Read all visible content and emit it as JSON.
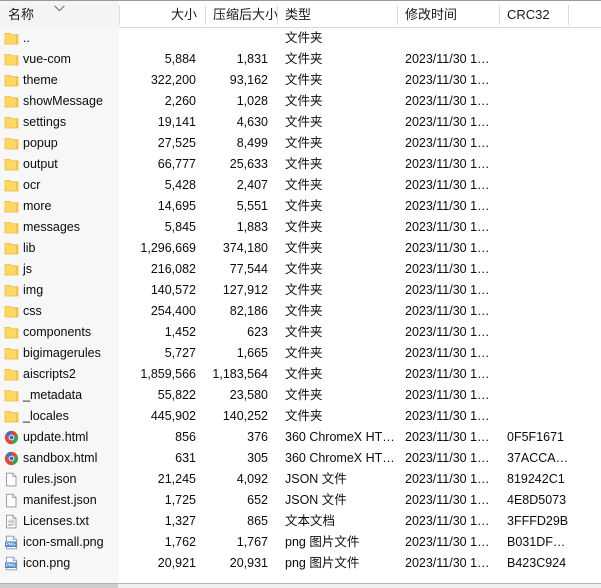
{
  "header": {
    "columns": [
      {
        "key": "name",
        "label": "名称",
        "align": "left",
        "sorted": true
      },
      {
        "key": "size",
        "label": "大小",
        "align": "right",
        "sorted": false
      },
      {
        "key": "packed",
        "label": "压缩后大小",
        "align": "right",
        "sorted": false
      },
      {
        "key": "type",
        "label": "类型",
        "align": "left",
        "sorted": false
      },
      {
        "key": "mtime",
        "label": "修改时间",
        "align": "left",
        "sorted": false
      },
      {
        "key": "crc",
        "label": "CRC32",
        "align": "left",
        "sorted": false
      }
    ],
    "sort_indicator_icon": "chevron-down-icon",
    "sort_column": "名称"
  },
  "type_labels": {
    "folder": "文件夹",
    "html": "360 ChromeX HT…",
    "json": "JSON 文件",
    "txt": "文本文档",
    "png": "png 图片文件"
  },
  "colors": {
    "folder_icon": "#ffd866",
    "folder_icon_border": "#e8b93d",
    "png_badge": "#4a86c8",
    "name_column_bg": "#f7f7f7",
    "header_rule": "#d8d8d8",
    "divider": "#dcdcdc",
    "text": "#0b0b0b"
  },
  "rows": [
    {
      "icon": "folder-icon",
      "name": "..",
      "size": "",
      "packed": "",
      "type": "文件夹",
      "mtime": "",
      "crc": ""
    },
    {
      "icon": "folder-icon",
      "name": "vue-com",
      "size": "5,884",
      "packed": "1,831",
      "type": "文件夹",
      "mtime": "2023/11/30 1…",
      "crc": ""
    },
    {
      "icon": "folder-icon",
      "name": "theme",
      "size": "322,200",
      "packed": "93,162",
      "type": "文件夹",
      "mtime": "2023/11/30 1…",
      "crc": ""
    },
    {
      "icon": "folder-icon",
      "name": "showMessage",
      "size": "2,260",
      "packed": "1,028",
      "type": "文件夹",
      "mtime": "2023/11/30 1…",
      "crc": ""
    },
    {
      "icon": "folder-icon",
      "name": "settings",
      "size": "19,141",
      "packed": "4,630",
      "type": "文件夹",
      "mtime": "2023/11/30 1…",
      "crc": ""
    },
    {
      "icon": "folder-icon",
      "name": "popup",
      "size": "27,525",
      "packed": "8,499",
      "type": "文件夹",
      "mtime": "2023/11/30 1…",
      "crc": ""
    },
    {
      "icon": "folder-icon",
      "name": "output",
      "size": "66,777",
      "packed": "25,633",
      "type": "文件夹",
      "mtime": "2023/11/30 1…",
      "crc": ""
    },
    {
      "icon": "folder-icon",
      "name": "ocr",
      "size": "5,428",
      "packed": "2,407",
      "type": "文件夹",
      "mtime": "2023/11/30 1…",
      "crc": ""
    },
    {
      "icon": "folder-icon",
      "name": "more",
      "size": "14,695",
      "packed": "5,551",
      "type": "文件夹",
      "mtime": "2023/11/30 1…",
      "crc": ""
    },
    {
      "icon": "folder-icon",
      "name": "messages",
      "size": "5,845",
      "packed": "1,883",
      "type": "文件夹",
      "mtime": "2023/11/30 1…",
      "crc": ""
    },
    {
      "icon": "folder-icon",
      "name": "lib",
      "size": "1,296,669",
      "packed": "374,180",
      "type": "文件夹",
      "mtime": "2023/11/30 1…",
      "crc": ""
    },
    {
      "icon": "folder-icon",
      "name": "js",
      "size": "216,082",
      "packed": "77,544",
      "type": "文件夹",
      "mtime": "2023/11/30 1…",
      "crc": ""
    },
    {
      "icon": "folder-icon",
      "name": "img",
      "size": "140,572",
      "packed": "127,912",
      "type": "文件夹",
      "mtime": "2023/11/30 1…",
      "crc": ""
    },
    {
      "icon": "folder-icon",
      "name": "css",
      "size": "254,400",
      "packed": "82,186",
      "type": "文件夹",
      "mtime": "2023/11/30 1…",
      "crc": ""
    },
    {
      "icon": "folder-icon",
      "name": "components",
      "size": "1,452",
      "packed": "623",
      "type": "文件夹",
      "mtime": "2023/11/30 1…",
      "crc": ""
    },
    {
      "icon": "folder-icon",
      "name": "bigimagerules",
      "size": "5,727",
      "packed": "1,665",
      "type": "文件夹",
      "mtime": "2023/11/30 1…",
      "crc": ""
    },
    {
      "icon": "folder-icon",
      "name": "aiscripts2",
      "size": "1,859,566",
      "packed": "1,183,564",
      "type": "文件夹",
      "mtime": "2023/11/30 1…",
      "crc": ""
    },
    {
      "icon": "folder-icon",
      "name": "_metadata",
      "size": "55,822",
      "packed": "23,580",
      "type": "文件夹",
      "mtime": "2023/11/30 1…",
      "crc": ""
    },
    {
      "icon": "folder-icon",
      "name": "_locales",
      "size": "445,902",
      "packed": "140,252",
      "type": "文件夹",
      "mtime": "2023/11/30 1…",
      "crc": ""
    },
    {
      "icon": "chrome-icon",
      "name": "update.html",
      "size": "856",
      "packed": "376",
      "type": "360 ChromeX HT…",
      "mtime": "2023/11/30 1…",
      "crc": "0F5F1671"
    },
    {
      "icon": "chrome-icon",
      "name": "sandbox.html",
      "size": "631",
      "packed": "305",
      "type": "360 ChromeX HT…",
      "mtime": "2023/11/30 1…",
      "crc": "37ACCA…"
    },
    {
      "icon": "document-icon",
      "name": "rules.json",
      "size": "21,245",
      "packed": "4,092",
      "type": "JSON 文件",
      "mtime": "2023/11/30 1…",
      "crc": "819242C1"
    },
    {
      "icon": "document-icon",
      "name": "manifest.json",
      "size": "1,725",
      "packed": "652",
      "type": "JSON 文件",
      "mtime": "2023/11/30 1…",
      "crc": "4E8D5073"
    },
    {
      "icon": "text-file-icon",
      "name": "Licenses.txt",
      "size": "1,327",
      "packed": "865",
      "type": "文本文档",
      "mtime": "2023/11/30 1…",
      "crc": "3FFFD29B"
    },
    {
      "icon": "png-file-icon",
      "name": "icon-small.png",
      "size": "1,762",
      "packed": "1,767",
      "type": "png 图片文件",
      "mtime": "2023/11/30 1…",
      "crc": "B031DF…"
    },
    {
      "icon": "png-file-icon",
      "name": "icon.png",
      "size": "20,921",
      "packed": "20,931",
      "type": "png 图片文件",
      "mtime": "2023/11/30 1…",
      "crc": "B423C924"
    }
  ],
  "scrollbar": {
    "orientation": "horizontal",
    "position": "bottom"
  }
}
